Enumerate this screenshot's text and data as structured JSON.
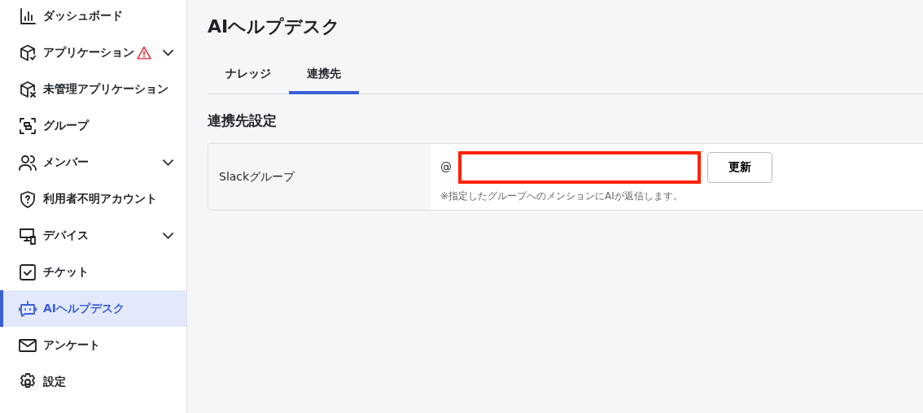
{
  "sidebar": {
    "items": [
      {
        "label": "ダッシュボード",
        "warning": false,
        "expandable": false,
        "selected": false
      },
      {
        "label": "アプリケーション",
        "warning": true,
        "expandable": true,
        "selected": false
      },
      {
        "label": "未管理アプリケーション",
        "warning": false,
        "expandable": false,
        "selected": false
      },
      {
        "label": "グループ",
        "warning": false,
        "expandable": false,
        "selected": false
      },
      {
        "label": "メンバー",
        "warning": false,
        "expandable": true,
        "selected": false
      },
      {
        "label": "利用者不明アカウント",
        "warning": false,
        "expandable": false,
        "selected": false
      },
      {
        "label": "デバイス",
        "warning": false,
        "expandable": true,
        "selected": false
      },
      {
        "label": "チケット",
        "warning": false,
        "expandable": false,
        "selected": false
      },
      {
        "label": "AIヘルプデスク",
        "warning": false,
        "expandable": false,
        "selected": true
      },
      {
        "label": "アンケート",
        "warning": false,
        "expandable": false,
        "selected": false
      },
      {
        "label": "設定",
        "warning": false,
        "expandable": false,
        "selected": false
      }
    ]
  },
  "page": {
    "title": "AIヘルプデスク",
    "tabs": [
      {
        "label": "ナレッジ",
        "selected": false
      },
      {
        "label": "連携先",
        "selected": true
      }
    ],
    "section_title": "連携先設定",
    "settings": [
      {
        "label": "Slackグループ",
        "prefix": "@",
        "highlighted": true,
        "button": "更新",
        "hint": "※指定したグループへのメンションにAIが返信します。"
      }
    ]
  }
}
